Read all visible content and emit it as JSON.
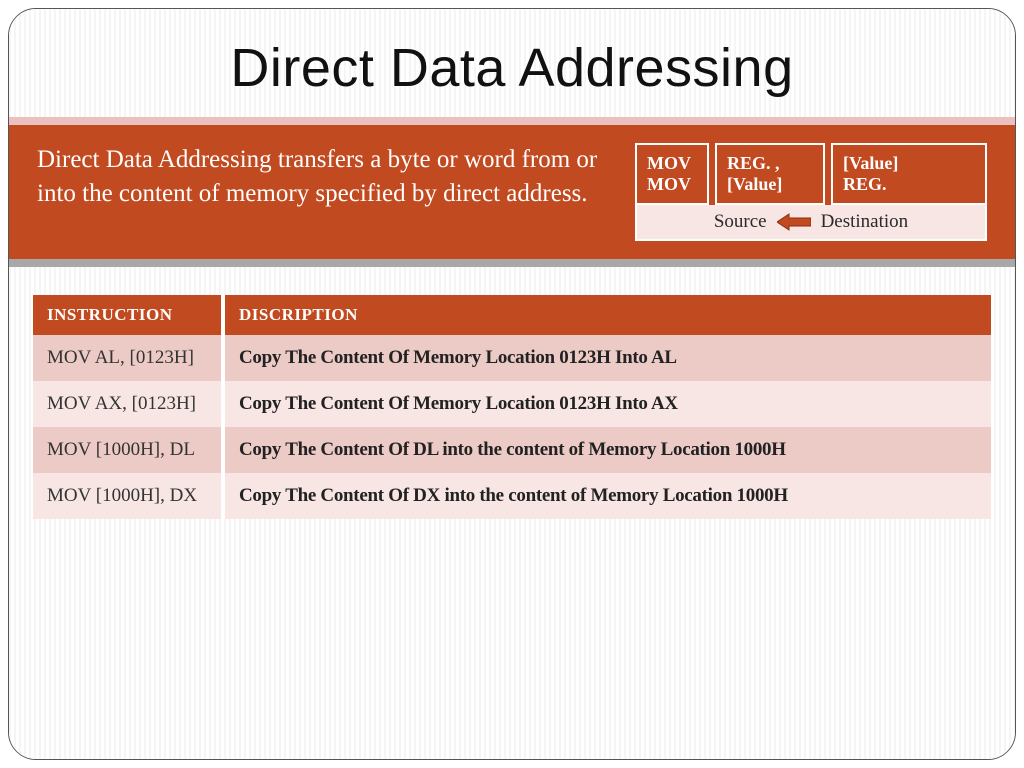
{
  "title": "Direct Data Addressing",
  "description": "Direct Data Addressing transfers a byte or word from or into the content of memory specified by direct address.",
  "syntax": {
    "col1": {
      "l1": "MOV",
      "l2": "MOV"
    },
    "col2": {
      "l1": "REG. ,",
      "l2": "[Value]"
    },
    "col3": {
      "l1": "[Value]",
      "l2": "REG."
    },
    "source": "Source",
    "destination": "Destination"
  },
  "table": {
    "headers": {
      "instruction": "INSTRUCTION",
      "description": "DISCRIPTION"
    },
    "rows": [
      {
        "inst": "MOV AL, [0123H]",
        "desc": "Copy The Content Of Memory Location 0123H Into AL"
      },
      {
        "inst": "MOV AX, [0123H]",
        "desc": "Copy The Content Of Memory Location 0123H Into AX"
      },
      {
        "inst": "MOV [1000H], DL",
        "desc": "Copy The Content Of DL into the content of Memory Location 1000H"
      },
      {
        "inst": "MOV [1000H], DX",
        "desc": "Copy The Content Of DX into the content of Memory Location 1000H"
      }
    ]
  }
}
